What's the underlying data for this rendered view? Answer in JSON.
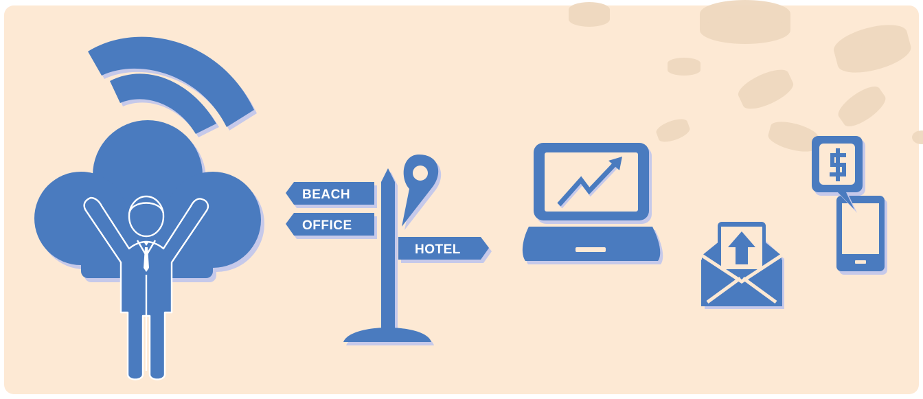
{
  "signpost": {
    "labels": {
      "beach": "BEACH",
      "office": "OFFICE",
      "hotel": "HOTEL"
    }
  },
  "icons": {
    "wifi": "wifi-signal-icon",
    "cloud": "cloud-icon",
    "person": "person-arms-raised-icon",
    "signpost": "signpost-icon",
    "map_pin": "map-pin-icon",
    "laptop": "laptop-growth-chart-icon",
    "envelope": "envelope-upload-icon",
    "phone": "smartphone-icon",
    "dollar_bubble": "dollar-speech-bubble-icon",
    "coins": "coin-icon"
  },
  "colors": {
    "background": "#fde9d4",
    "icon_blue": "#4a7bbf",
    "icon_shadow": "#c6c9ea",
    "coin": "#f0dcc3"
  }
}
